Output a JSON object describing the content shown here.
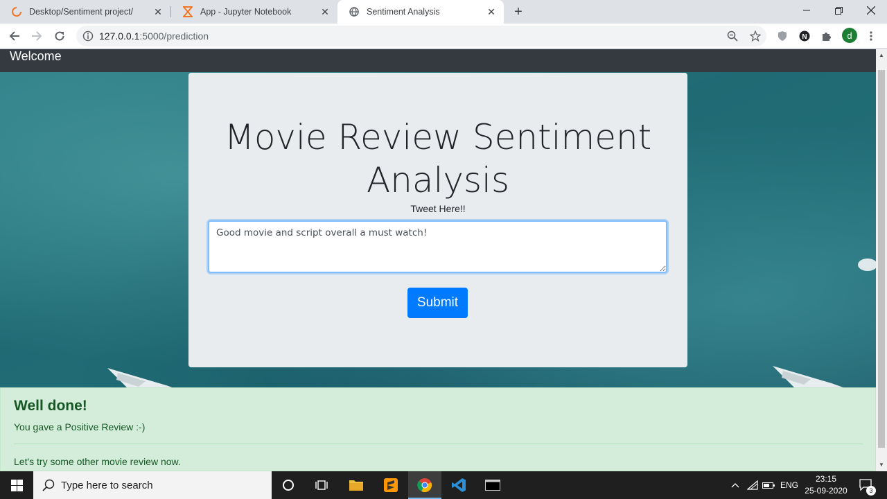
{
  "browser": {
    "tabs": [
      {
        "title": "Desktop/Sentiment project/",
        "icon": "jupyter-loading-icon"
      },
      {
        "title": "App - Jupyter Notebook",
        "icon": "hourglass-icon"
      },
      {
        "title": "Sentiment Analysis",
        "icon": "globe-icon",
        "active": true
      }
    ],
    "url_host": "127.0.0.1",
    "url_path": ":5000/prediction",
    "profile_initial": "d"
  },
  "page": {
    "navbar_brand": "Welcome",
    "heading": "Movie Review Sentiment Analysis",
    "input_label": "Tweet Here!!",
    "review_text": "Good movie and script overall a must watch!",
    "submit_label": "Submit",
    "alert": {
      "title": "Well done!",
      "message": "You gave a Positive Review :-)",
      "followup": "Let's try some other movie review now."
    },
    "colors": {
      "primary": "#007bff",
      "navbar": "#343a40",
      "alert_bg": "#d4edda",
      "alert_text": "#155724"
    }
  },
  "taskbar": {
    "search_placeholder": "Type here to search",
    "language": "ENG",
    "time": "23:15",
    "date": "25-09-2020",
    "notification_count": "3"
  }
}
